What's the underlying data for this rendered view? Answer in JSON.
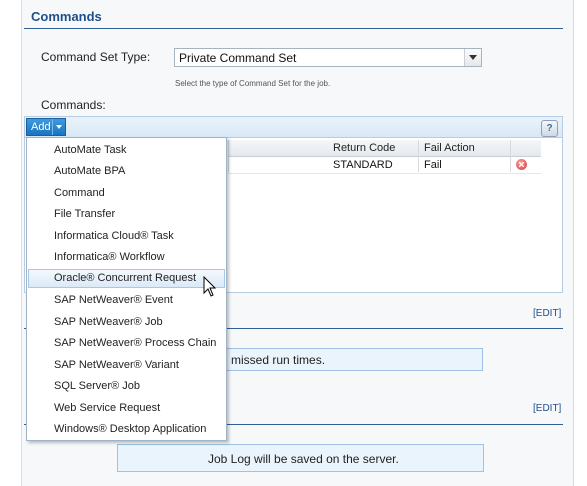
{
  "section": {
    "title": "Commands"
  },
  "command_set": {
    "label": "Command Set Type:",
    "value": "Private Command Set",
    "hint": "Select the type of Command Set for the job."
  },
  "commands": {
    "label": "Commands:",
    "add_label": "Add",
    "help": "?",
    "columns": [
      "Return Code",
      "Fail Action"
    ],
    "row": {
      "return_code": "STANDARD",
      "fail_action": "Fail"
    }
  },
  "edit_links": [
    "[EDIT]",
    "[EDIT]"
  ],
  "messages": {
    "missed": "missed run times.",
    "job_log": "Job Log will be saved on the server."
  },
  "menu": {
    "items": [
      "AutoMate Task",
      "AutoMate BPA",
      "Command",
      "File Transfer",
      "Informatica Cloud® Task",
      "Informatica® Workflow",
      "Oracle® Concurrent Request",
      "SAP NetWeaver® Event",
      "SAP NetWeaver® Job",
      "SAP NetWeaver® Process Chain",
      "SAP NetWeaver® Variant",
      "SQL Server® Job",
      "Web Service Request",
      "Windows® Desktop Application"
    ],
    "highlighted": "Oracle® Concurrent Request"
  },
  "colors": {
    "accent": "#1f4f8b",
    "button": "#1a73c2"
  }
}
